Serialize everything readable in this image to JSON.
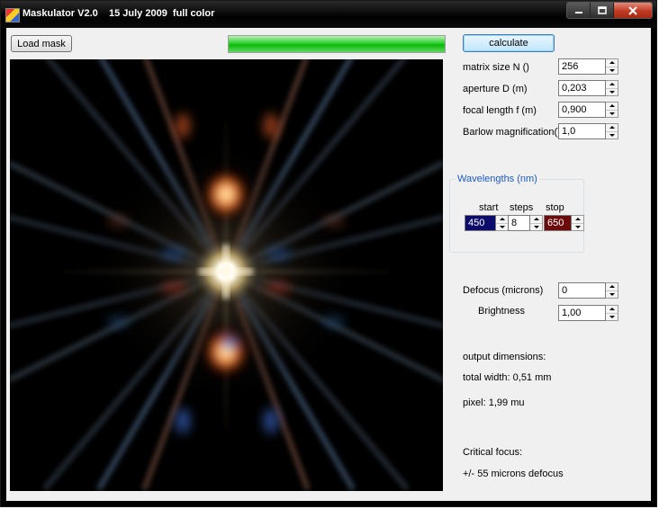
{
  "window": {
    "title": "Maskulator V2.0    15 July 2009  full color"
  },
  "toolbar": {
    "load_mask_label": "Load mask",
    "calculate_label": "calculate",
    "progress_fraction": 1.0
  },
  "params": {
    "matrix_size_label": "matrix size N ()",
    "matrix_size_value": "256",
    "aperture_label": "aperture D (m)",
    "aperture_value": "0,203",
    "focal_label": "focal length f (m)",
    "focal_value": "0,900",
    "barlow_label": "Barlow magnification()",
    "barlow_value": "1,0"
  },
  "wavelengths": {
    "group_label": "Wavelengths (nm)",
    "start_label": "start",
    "start_value": "450",
    "start_color": "#0b0b6b",
    "steps_label": "steps",
    "steps_value": "8",
    "stop_label": "stop",
    "stop_value": "650",
    "stop_color": "#6b0b0b"
  },
  "focus": {
    "defocus_label": "Defocus (microns)",
    "defocus_value": "0",
    "brightness_label": "Brightness",
    "brightness_value": "1,00"
  },
  "output": {
    "heading": "output dimensions:",
    "total_width": "total width: 0,51 mm",
    "pixel": "pixel: 1,99 mu"
  },
  "critical": {
    "heading": "Critical focus:",
    "value": "+/- 55 microns defocus"
  },
  "icons": {
    "app": "app-icon",
    "minimize": "minimize-icon",
    "maximize": "maximize-icon",
    "close": "close-icon",
    "spin_up": "arrow-up-icon",
    "spin_down": "arrow-down-icon"
  }
}
